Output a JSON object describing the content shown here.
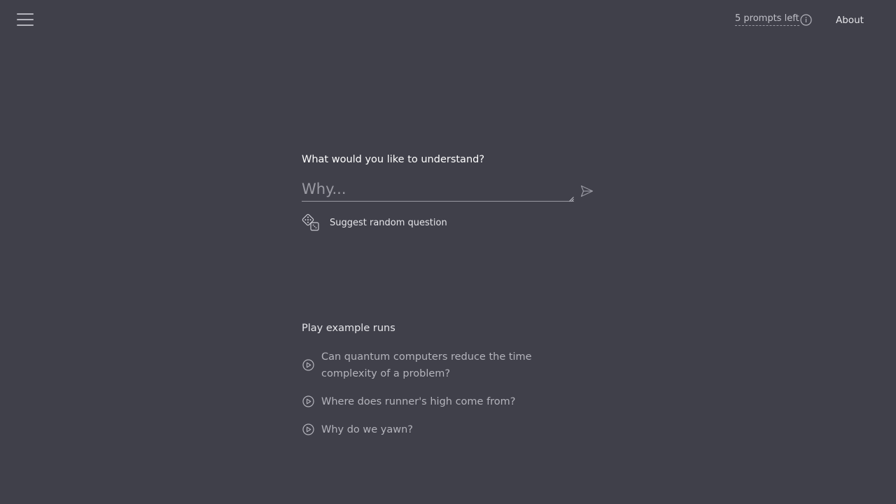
{
  "header": {
    "prompts_left": "5 prompts left",
    "about": "About"
  },
  "main": {
    "question_heading": "What would you like to understand?",
    "input_placeholder": "Why...",
    "random_question_label": "Suggest random question",
    "examples_heading": "Play example runs",
    "examples": [
      "Can quantum computers reduce the time complexity of a problem?",
      "Where does runner's high come from?",
      "Why do we yawn?"
    ]
  },
  "colors": {
    "background": "#40404a",
    "text_primary": "#e6e6ea",
    "text_muted": "#b4b4bc"
  }
}
